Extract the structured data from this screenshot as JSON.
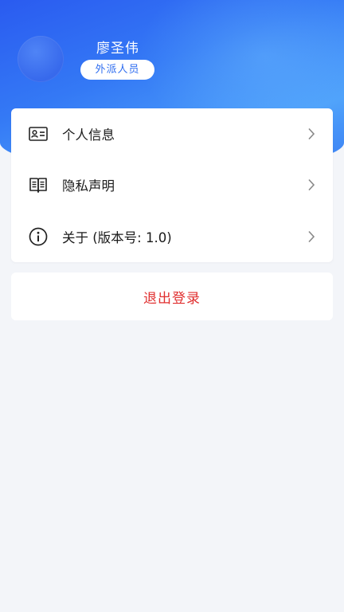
{
  "profile": {
    "name": "廖圣伟",
    "role": "外派人员"
  },
  "menu": {
    "items": [
      {
        "label": "个人信息",
        "icon": "id-card-icon"
      },
      {
        "label": "隐私声明",
        "icon": "book-icon"
      },
      {
        "label": "关于 (版本号: 1.0)",
        "icon": "info-icon"
      }
    ]
  },
  "logout": {
    "label": "退出登录"
  },
  "colors": {
    "accent": "#2f6ef0",
    "logout": "#e02f2f",
    "background": "#f3f5f9"
  }
}
